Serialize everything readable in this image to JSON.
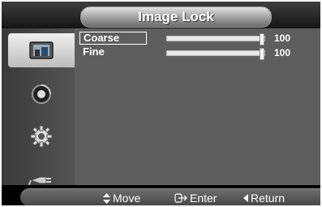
{
  "header": {
    "title": "Image Lock"
  },
  "sidebar": {
    "items": [
      {
        "icon": "picture-icon",
        "active": true
      },
      {
        "icon": "sound-icon",
        "active": false
      },
      {
        "icon": "setup-gear-icon",
        "active": false
      },
      {
        "icon": "input-plug-icon",
        "active": false
      }
    ]
  },
  "settings": [
    {
      "label": "Coarse",
      "value": "100",
      "level_percent": 100,
      "focused": true
    },
    {
      "label": "Fine",
      "value": "100",
      "level_percent": 100,
      "focused": false
    }
  ],
  "footer": {
    "move_icon": "updown-arrows-icon",
    "move_label": "Move",
    "enter_icon": "enter-icon",
    "enter_label": "Enter",
    "return_icon": "left-arrow-icon",
    "return_label": "Return"
  }
}
